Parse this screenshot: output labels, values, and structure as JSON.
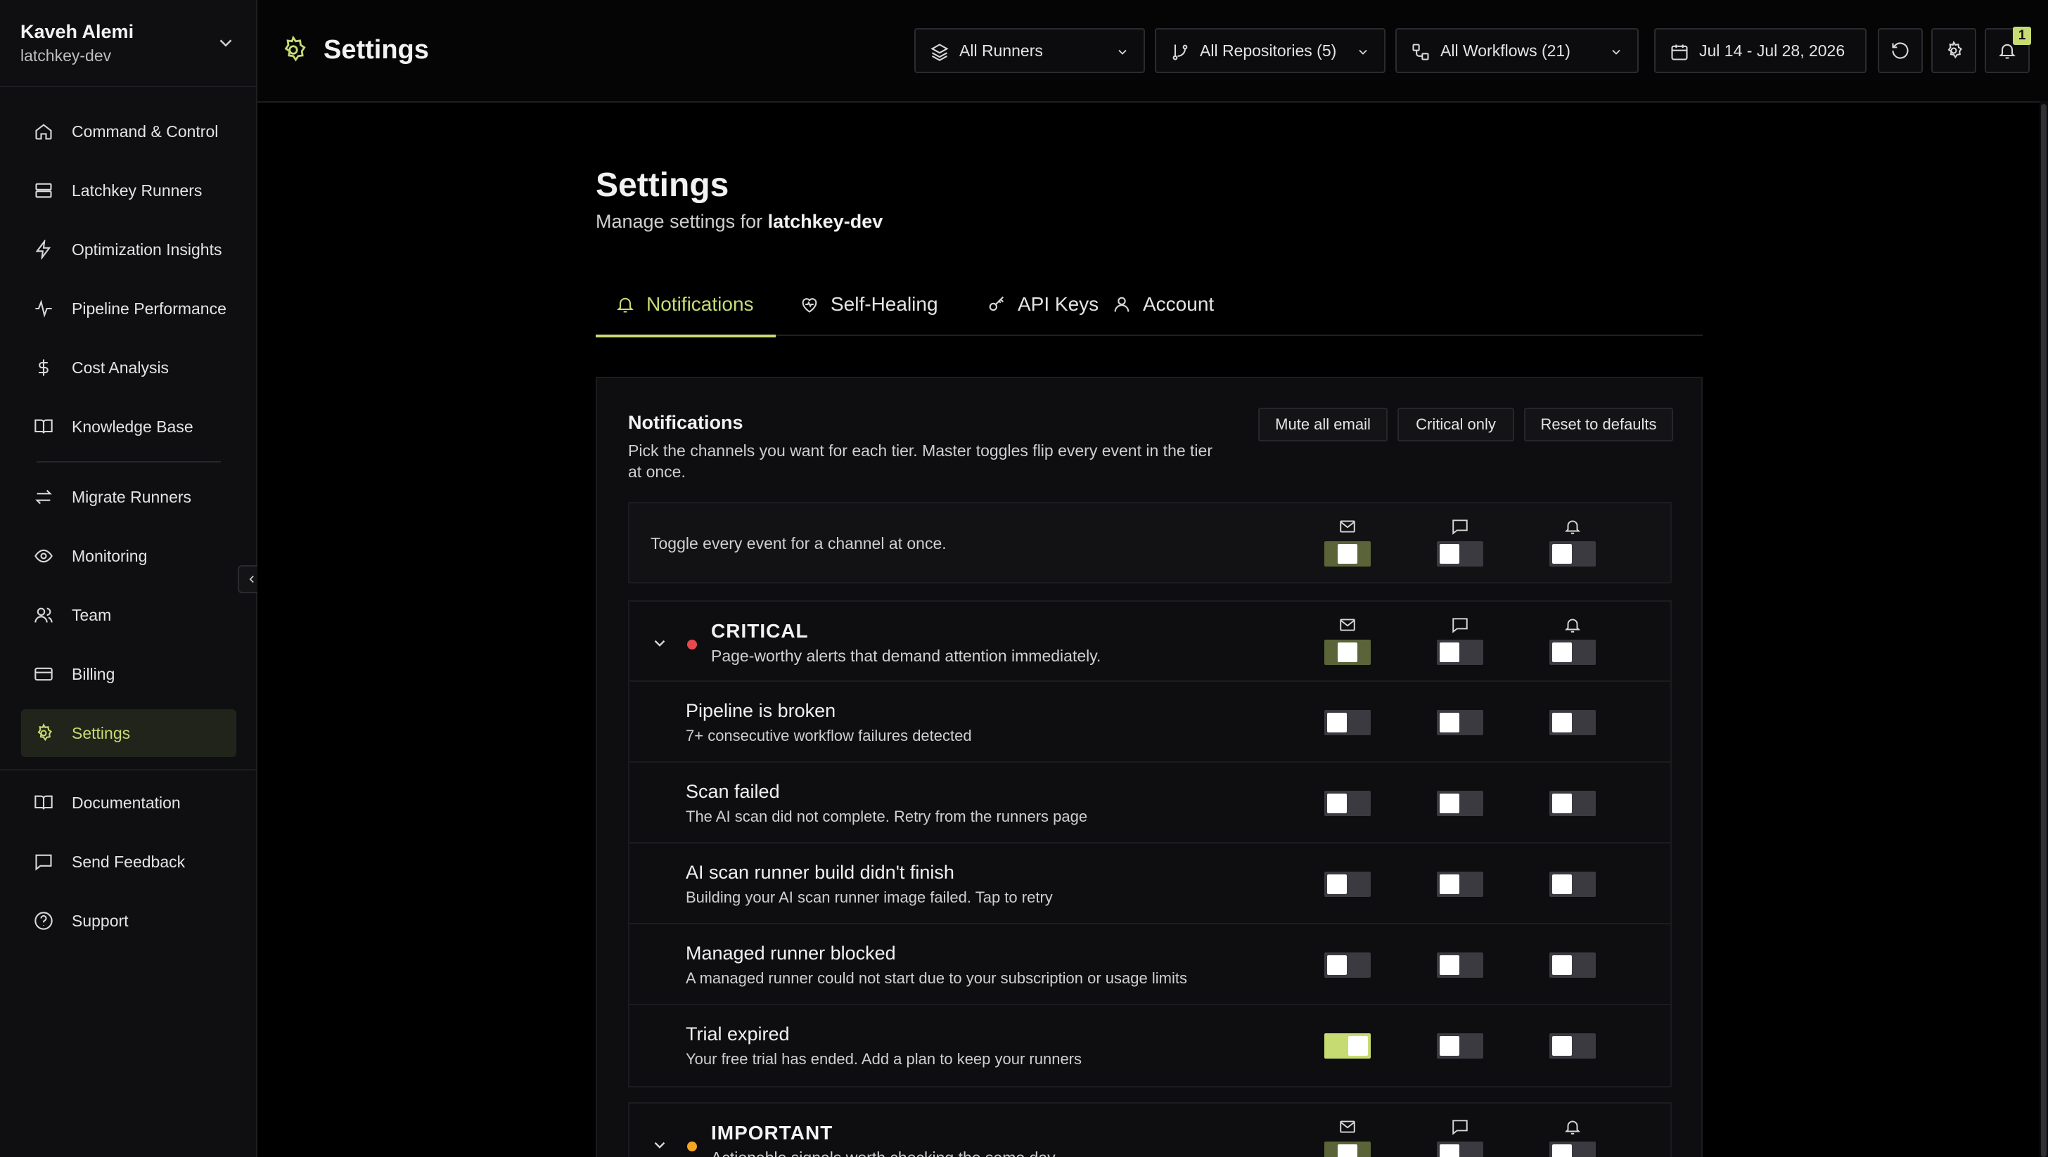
{
  "user": {
    "name": "Kaveh Alemi",
    "org": "latchkey-dev"
  },
  "sidebar": {
    "items": [
      {
        "label": "Command & Control",
        "icon": "home-icon"
      },
      {
        "label": "Latchkey Runners",
        "icon": "server-icon"
      },
      {
        "label": "Optimization Insights",
        "icon": "bolt-icon"
      },
      {
        "label": "Pipeline Performance",
        "icon": "activity-icon"
      },
      {
        "label": "Cost Analysis",
        "icon": "dollar-icon"
      },
      {
        "label": "Knowledge Base",
        "icon": "book-icon"
      },
      {
        "label": "Migrate Runners",
        "icon": "arrows-icon"
      },
      {
        "label": "Monitoring",
        "icon": "eye-icon"
      },
      {
        "label": "Team",
        "icon": "users-icon"
      },
      {
        "label": "Billing",
        "icon": "card-icon"
      },
      {
        "label": "Settings",
        "icon": "gear-icon",
        "active": true
      },
      {
        "label": "Documentation",
        "icon": "book-icon"
      },
      {
        "label": "Send Feedback",
        "icon": "chat-icon"
      },
      {
        "label": "Support",
        "icon": "help-icon"
      }
    ]
  },
  "header": {
    "title": "Settings",
    "filters": {
      "runners": "All Runners",
      "repositories": "All Repositories (5)",
      "workflows": "All Workflows (21)",
      "date_range": "Jul 14 - Jul 28, 2026"
    },
    "notification_count": "1"
  },
  "page": {
    "title": "Settings",
    "subtitle_prefix": "Manage settings for ",
    "subtitle_org": "latchkey-dev"
  },
  "tabs": [
    {
      "label": "Notifications",
      "active": true
    },
    {
      "label": "Self-Healing"
    },
    {
      "label": "API Keys"
    },
    {
      "label": "Account"
    }
  ],
  "notifications": {
    "title": "Notifications",
    "description": "Pick the channels you want for each tier. Master toggles flip every event in the tier at once.",
    "actions": {
      "mute_all": "Mute all email",
      "critical_only": "Critical only",
      "reset": "Reset to defaults"
    },
    "master_text": "Toggle every event for a channel at once.",
    "channels": [
      "mail-icon",
      "chat-icon",
      "bell-icon"
    ],
    "master_toggles": [
      "partial",
      "off",
      "off"
    ],
    "tiers": [
      {
        "name": "CRITICAL",
        "description": "Page-worthy alerts that demand attention immediately.",
        "dot_color": "#e5484d",
        "toggles": [
          "partial",
          "off",
          "off"
        ],
        "events": [
          {
            "title": "Pipeline is broken",
            "description": "7+ consecutive workflow failures detected",
            "toggles": [
              "off",
              "off",
              "off"
            ]
          },
          {
            "title": "Scan failed",
            "description": "The AI scan did not complete. Retry from the runners page",
            "toggles": [
              "off",
              "off",
              "off"
            ]
          },
          {
            "title": "AI scan runner build didn't finish",
            "description": "Building your AI scan runner image failed. Tap to retry",
            "toggles": [
              "off",
              "off",
              "off"
            ]
          },
          {
            "title": "Managed runner blocked",
            "description": "A managed runner could not start due to your subscription or usage limits",
            "toggles": [
              "off",
              "off",
              "off"
            ]
          },
          {
            "title": "Trial expired",
            "description": "Your free trial has ended. Add a plan to keep your runners",
            "toggles": [
              "on",
              "off",
              "off"
            ]
          }
        ]
      },
      {
        "name": "IMPORTANT",
        "description": "Actionable signals worth checking the same day.",
        "dot_color": "#f5a524",
        "toggles": [
          "partial",
          "off",
          "off"
        ],
        "events": []
      }
    ]
  },
  "colors": {
    "accent": "#c6dc73",
    "critical": "#e5484d",
    "important": "#f5a524"
  }
}
